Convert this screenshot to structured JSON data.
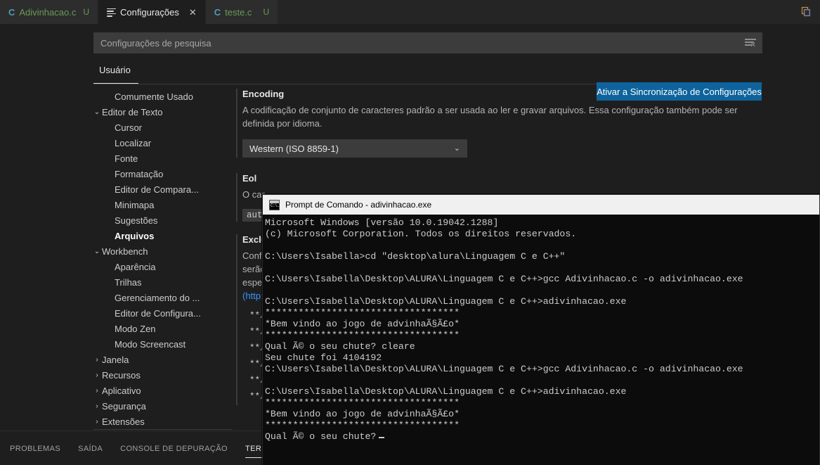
{
  "tabs": [
    {
      "icon": "c-file-icon",
      "label": "Adivinhacao.c",
      "modified": "U",
      "active": false,
      "closable": false
    },
    {
      "icon": "settings-icon",
      "label": "Configurações",
      "modified": "",
      "active": true,
      "closable": true
    },
    {
      "icon": "c-file-icon",
      "label": "teste.c",
      "modified": "U",
      "active": false,
      "closable": false
    }
  ],
  "tabbar": {
    "split_editor_icon": "split-editor-icon",
    "close_label": "✕"
  },
  "settings": {
    "search": {
      "placeholder": "Configurações de pesquisa",
      "value": "",
      "filter_icon": "clear-filter-icon"
    },
    "scope_tab": "Usuário",
    "sync_button": "Ativar a Sincronização de Configurações",
    "toc": [
      {
        "label": "Comumente Usado",
        "indent": 1,
        "chevron": "",
        "selected": false
      },
      {
        "label": "Editor de Texto",
        "indent": 0,
        "chevron": "⌄",
        "selected": false
      },
      {
        "label": "Cursor",
        "indent": 1,
        "chevron": "",
        "selected": false
      },
      {
        "label": "Localizar",
        "indent": 1,
        "chevron": "",
        "selected": false
      },
      {
        "label": "Fonte",
        "indent": 1,
        "chevron": "",
        "selected": false
      },
      {
        "label": "Formatação",
        "indent": 1,
        "chevron": "",
        "selected": false
      },
      {
        "label": "Editor de Compara...",
        "indent": 1,
        "chevron": "",
        "selected": false
      },
      {
        "label": "Minimapa",
        "indent": 1,
        "chevron": "",
        "selected": false
      },
      {
        "label": "Sugestões",
        "indent": 1,
        "chevron": "",
        "selected": false
      },
      {
        "label": "Arquivos",
        "indent": 1,
        "chevron": "",
        "selected": true
      },
      {
        "label": "Workbench",
        "indent": 0,
        "chevron": "⌄",
        "selected": false
      },
      {
        "label": "Aparência",
        "indent": 1,
        "chevron": "",
        "selected": false
      },
      {
        "label": "Trilhas",
        "indent": 1,
        "chevron": "",
        "selected": false
      },
      {
        "label": "Gerenciamento do ...",
        "indent": 1,
        "chevron": "",
        "selected": false
      },
      {
        "label": "Editor de Configura...",
        "indent": 1,
        "chevron": "",
        "selected": false
      },
      {
        "label": "Modo Zen",
        "indent": 1,
        "chevron": "",
        "selected": false
      },
      {
        "label": "Modo Screencast",
        "indent": 1,
        "chevron": "",
        "selected": false
      },
      {
        "label": "Janela",
        "indent": 0,
        "chevron": "›",
        "selected": false
      },
      {
        "label": "Recursos",
        "indent": 0,
        "chevron": "›",
        "selected": false
      },
      {
        "label": "Aplicativo",
        "indent": 0,
        "chevron": "›",
        "selected": false
      },
      {
        "label": "Segurança",
        "indent": 0,
        "chevron": "›",
        "selected": false
      },
      {
        "label": "Extensões",
        "indent": 0,
        "chevron": "›",
        "selected": false
      }
    ],
    "encoding": {
      "title": "Encoding",
      "description": "A codificação de conjunto de caracteres padrão a ser usada ao ler e gravar arquivos. Essa configuração também pode ser definida por idioma.",
      "value": "Western (ISO 8859-1)",
      "chevron": "⌄"
    },
    "eol": {
      "title": "Eol",
      "description_visible": "O car",
      "value_chip": "auto"
    },
    "exclude": {
      "title": "Exclu",
      "desc_line1": "Confi",
      "desc_line2": "serão",
      "desc_line3": "espec",
      "desc_link": "(http:",
      "patterns": [
        "**/.",
        "**/.",
        "**/.",
        "**/(",
        "**/.",
        "**/."
      ]
    }
  },
  "panel": {
    "tabs": [
      {
        "label": "PROBLEMAS",
        "active": false
      },
      {
        "label": "SAÍDA",
        "active": false
      },
      {
        "label": "CONSOLE DE DEPURAÇÃO",
        "active": false
      },
      {
        "label": "TERMINAL",
        "active": true
      }
    ]
  },
  "cmd": {
    "title": "Prompt de Comando - adivinhacao.exe",
    "icon": "cmd-console-icon",
    "lines": [
      "Microsoft Windows [versão 10.0.19042.1288]",
      "(c) Microsoft Corporation. Todos os direitos reservados.",
      "",
      "C:\\Users\\Isabella>cd \"desktop\\alura\\Linguagem C e C++\"",
      "",
      "C:\\Users\\Isabella\\Desktop\\ALURA\\Linguagem C e C++>gcc Adivinhacao.c -o adivinhacao.exe",
      "",
      "C:\\Users\\Isabella\\Desktop\\ALURA\\Linguagem C e C++>adivinhacao.exe",
      "***********************************",
      "*Bem vindo ao jogo de advinhaÃ§Ã£o*",
      "***********************************",
      "Qual Ã© o seu chute? cleare",
      "Seu chute foi 4104192",
      "C:\\Users\\Isabella\\Desktop\\ALURA\\Linguagem C e C++>gcc Adivinhacao.c -o adivinhacao.exe",
      "",
      "C:\\Users\\Isabella\\Desktop\\ALURA\\Linguagem C e C++>adivinhacao.exe",
      "***********************************",
      "*Bem vindo ao jogo de advinhaÃ§Ã£o*",
      "***********************************",
      "Qual Ã© o seu chute?"
    ],
    "cursor_line_index": 19
  },
  "colors": {
    "accent": "#0e639c",
    "editor_bg": "#1e1e1e",
    "tabbar_bg": "#252526",
    "scrollbar": "#3b9fd0",
    "cmd_bg": "#0c0c0c",
    "cmd_title_bg": "#f0f0f0",
    "link": "#3794ff",
    "file_green": "#6a9955"
  }
}
